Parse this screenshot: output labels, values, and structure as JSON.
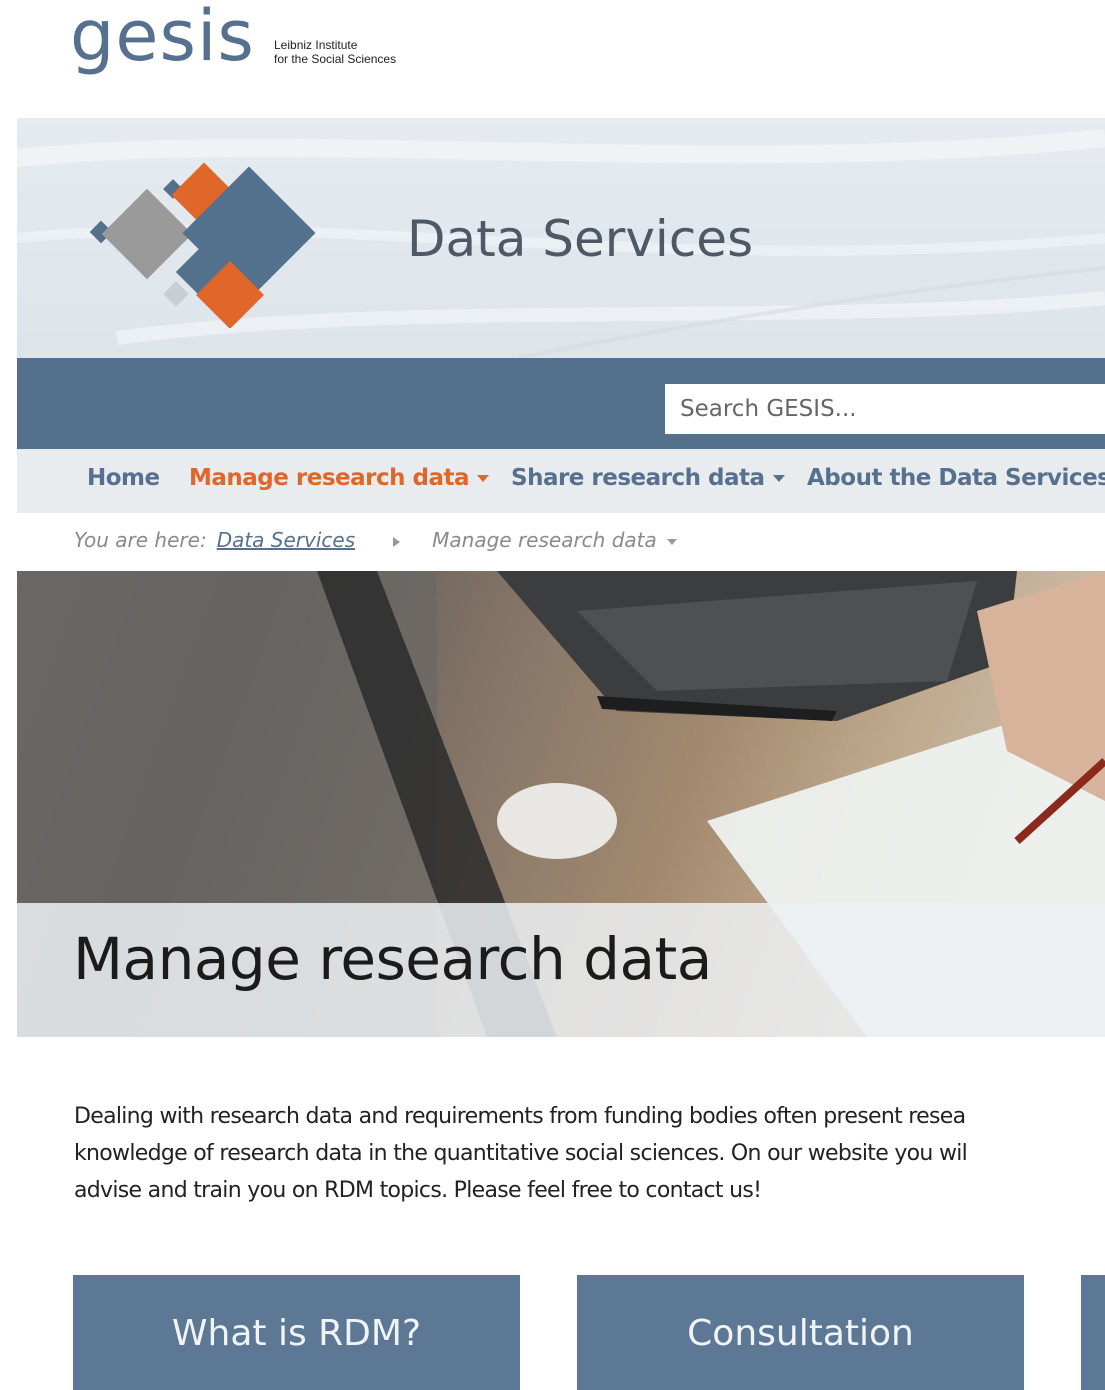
{
  "logo": {
    "wordmark": "gesis",
    "subtitle_line1": "Leibniz Institute",
    "subtitle_line2": "for the Social Sciences"
  },
  "banner": {
    "title": "Data Services"
  },
  "search": {
    "placeholder": "Search GESIS..."
  },
  "nav": {
    "items": [
      {
        "label": "Home"
      },
      {
        "label": "Manage research data",
        "active": true
      },
      {
        "label": "Share research data"
      },
      {
        "label": "About the Data Services"
      }
    ]
  },
  "breadcrumb": {
    "prefix": "You are here:",
    "link": "Data Services",
    "current": "Manage research data"
  },
  "hero": {
    "title": "Manage research data"
  },
  "intro": {
    "line1": "Dealing with research data and requirements from funding bodies often present resea",
    "line2": "knowledge of research data in the quantitative social sciences. On our website you wil",
    "line3": "advise and train you on RDM topics. Please feel free to contact us!"
  },
  "cards": [
    {
      "label": "What is RDM?"
    },
    {
      "label": "Consultation"
    }
  ],
  "colors": {
    "brand_blue": "#56708f",
    "accent_orange": "#e0662a",
    "card_blue": "#5c7894"
  }
}
